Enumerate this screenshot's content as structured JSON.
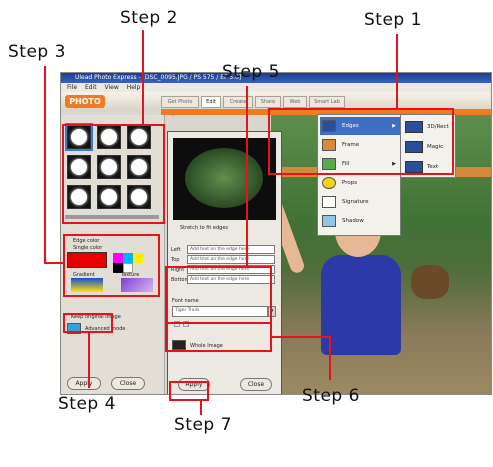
{
  "steps": {
    "step1": "Step 1",
    "step2": "Step 2",
    "step3": "Step 3",
    "step4": "Step 4",
    "step5": "Step 5",
    "step6": "Step 6",
    "step7": "Step 7"
  },
  "window": {
    "title": "Ulead Photo Express - [DSC_0095.JPG / PS 575 / EF 5.0]",
    "menu": [
      "File",
      "Edit",
      "View",
      "Help"
    ],
    "logo": "PHOTO",
    "tabs": [
      "Get Photo",
      "Edit",
      "Create",
      "Share",
      "Web",
      "Smart Lab"
    ]
  },
  "effect_menu": {
    "items": [
      {
        "label": "Edges",
        "has_submenu": true
      },
      {
        "label": "Frame",
        "has_submenu": false
      },
      {
        "label": "Fill",
        "has_submenu": true
      },
      {
        "label": "Props",
        "has_submenu": false
      },
      {
        "label": "Signature",
        "has_submenu": false
      },
      {
        "label": "Shadow",
        "has_submenu": false
      }
    ],
    "submenu": [
      "3D/Rect",
      "Magic",
      "Text"
    ]
  },
  "left_panel": {
    "edge_color_label": "Edge color",
    "single_color_label": "Single color",
    "gradient_label": "Gradient",
    "texture_label": "Texture",
    "keep_original_label": "Keep original image",
    "advanced_label": "Advanced mode",
    "apply": "Apply",
    "close": "Close",
    "colors": [
      "#e60000",
      "#ff00ff",
      "#00b4ff",
      "#ffee00",
      "#000000",
      "#ffffff",
      "#1a4cd8",
      "#7c3fd0"
    ]
  },
  "dialog": {
    "stretch_label": "Stretch to fit edges",
    "fields": [
      {
        "label": "Left",
        "value": "Add text on the edge here"
      },
      {
        "label": "Top",
        "value": "Add text on the edge here"
      },
      {
        "label": "Right",
        "value": "Add text on the edge here"
      },
      {
        "label": "Bottom",
        "value": "Add text on the edge here"
      }
    ],
    "font_label": "Font name",
    "font_value": "Tiger Trails",
    "color_label": "Whole Image",
    "apply": "Apply",
    "close": "Close"
  }
}
